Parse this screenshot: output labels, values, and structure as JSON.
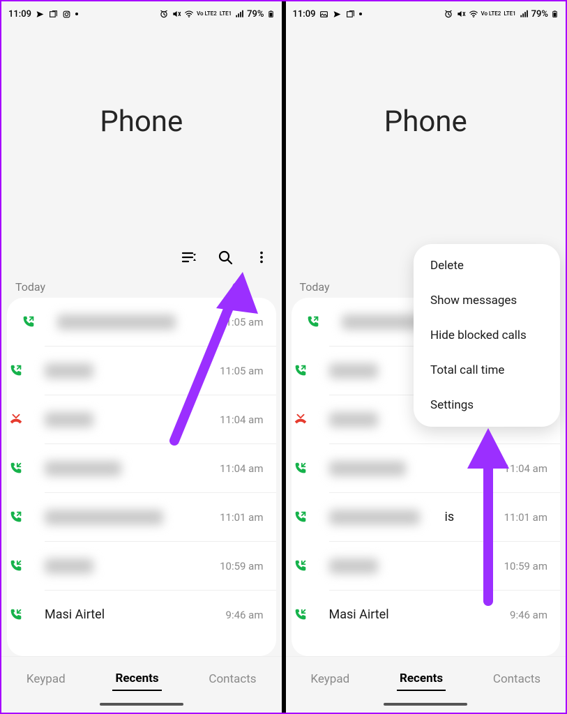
{
  "status": {
    "time": "11:09",
    "battery_pct": "79%",
    "lte_label": "LTE1",
    "volte_label": "Vo LTE2"
  },
  "header": {
    "title": "Phone"
  },
  "section": {
    "today": "Today"
  },
  "calls": [
    {
      "kind": "out",
      "name": "",
      "time": "11:05 am"
    },
    {
      "kind": "out",
      "name": "",
      "time": "11:05 am"
    },
    {
      "kind": "missed",
      "name": "",
      "time": "11:04 am"
    },
    {
      "kind": "in",
      "name": "",
      "time": "11:04 am"
    },
    {
      "kind": "out",
      "name": "",
      "time": "11:01 am"
    },
    {
      "kind": "in",
      "name": "",
      "time": "10:59 am"
    },
    {
      "kind": "in",
      "name": "Masi Airtel",
      "time": "9:46 am"
    }
  ],
  "tabs": {
    "keypad": "Keypad",
    "recents": "Recents",
    "contacts": "Contacts"
  },
  "menu": {
    "delete": "Delete",
    "show_messages": "Show messages",
    "hide_blocked": "Hide blocked calls",
    "total_time": "Total call time",
    "settings": "Settings"
  },
  "right_partial_name": "is",
  "right_partial_time": "11:04 am"
}
